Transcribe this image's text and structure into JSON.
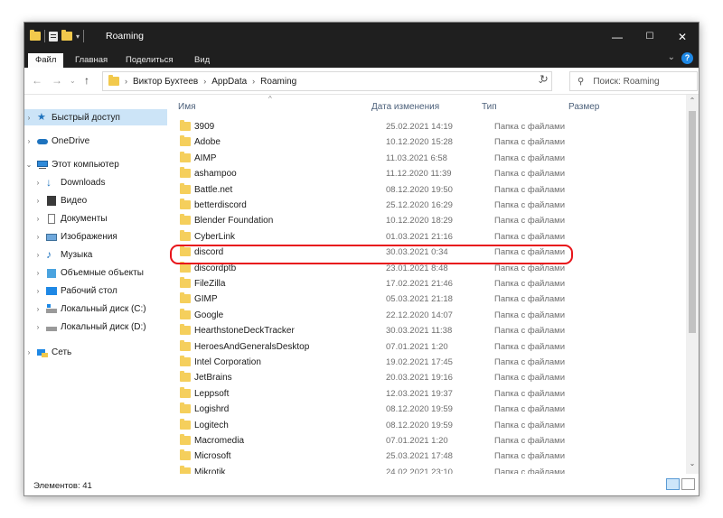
{
  "window": {
    "title": "Roaming",
    "controls": {
      "minimize": "—",
      "maximize": "☐",
      "close": "✕"
    }
  },
  "ribbon": {
    "tabs": [
      "Файл",
      "Главная",
      "Поделиться",
      "Вид"
    ],
    "help": "?"
  },
  "address": {
    "breadcrumbs": [
      "Виктор Бухтеев",
      "AppData",
      "Roaming"
    ],
    "search_placeholder": "Поиск: Roaming"
  },
  "nav": {
    "items": [
      {
        "label": "Быстрый доступ",
        "icon": "star-icon",
        "selected": true
      },
      {
        "label": "OneDrive",
        "icon": "cloud-icon"
      },
      {
        "label": "Этот компьютер",
        "icon": "computer-icon",
        "expanded": true
      },
      {
        "label": "Downloads",
        "icon": "download-icon"
      },
      {
        "label": "Видео",
        "icon": "video-icon"
      },
      {
        "label": "Документы",
        "icon": "document-icon"
      },
      {
        "label": "Изображения",
        "icon": "image-icon"
      },
      {
        "label": "Музыка",
        "icon": "music-icon"
      },
      {
        "label": "Объемные объекты",
        "icon": "cube-icon"
      },
      {
        "label": "Рабочий стол",
        "icon": "desktop-icon"
      },
      {
        "label": "Локальный диск (C:)",
        "icon": "drive-icon"
      },
      {
        "label": "Локальный диск (D:)",
        "icon": "drive-icon"
      },
      {
        "label": "Сеть",
        "icon": "network-icon"
      }
    ]
  },
  "columns": {
    "name": "Имя",
    "date": "Дата изменения",
    "type": "Тип",
    "size": "Размер"
  },
  "files": [
    {
      "name": "3909",
      "date": "25.02.2021 14:19",
      "type": "Папка с файлами"
    },
    {
      "name": "Adobe",
      "date": "10.12.2020 15:28",
      "type": "Папка с файлами"
    },
    {
      "name": "AIMP",
      "date": "11.03.2021 6:58",
      "type": "Папка с файлами"
    },
    {
      "name": "ashampoo",
      "date": "11.12.2020 11:39",
      "type": "Папка с файлами"
    },
    {
      "name": "Battle.net",
      "date": "08.12.2020 19:50",
      "type": "Папка с файлами"
    },
    {
      "name": "betterdiscord",
      "date": "25.12.2020 16:29",
      "type": "Папка с файлами"
    },
    {
      "name": "Blender Foundation",
      "date": "10.12.2020 18:29",
      "type": "Папка с файлами"
    },
    {
      "name": "CyberLink",
      "date": "01.03.2021 21:16",
      "type": "Папка с файлами"
    },
    {
      "name": "discord",
      "date": "30.03.2021 0:34",
      "type": "Папка с файлами",
      "highlighted": true
    },
    {
      "name": "discordptb",
      "date": "23.01.2021 8:48",
      "type": "Папка с файлами"
    },
    {
      "name": "FileZilla",
      "date": "17.02.2021 21:46",
      "type": "Папка с файлами"
    },
    {
      "name": "GIMP",
      "date": "05.03.2021 21:18",
      "type": "Папка с файлами"
    },
    {
      "name": "Google",
      "date": "22.12.2020 14:07",
      "type": "Папка с файлами"
    },
    {
      "name": "HearthstoneDeckTracker",
      "date": "30.03.2021 11:38",
      "type": "Папка с файлами"
    },
    {
      "name": "HeroesAndGeneralsDesktop",
      "date": "07.01.2021 1:20",
      "type": "Папка с файлами"
    },
    {
      "name": "Intel Corporation",
      "date": "19.02.2021 17:45",
      "type": "Папка с файлами"
    },
    {
      "name": "JetBrains",
      "date": "20.03.2021 19:16",
      "type": "Папка с файлами"
    },
    {
      "name": "Leppsoft",
      "date": "12.03.2021 19:37",
      "type": "Папка с файлами"
    },
    {
      "name": "Logishrd",
      "date": "08.12.2020 19:59",
      "type": "Папка с файлами"
    },
    {
      "name": "Logitech",
      "date": "08.12.2020 19:59",
      "type": "Папка с файлами"
    },
    {
      "name": "Macromedia",
      "date": "07.01.2021 1:20",
      "type": "Папка с файлами"
    },
    {
      "name": "Microsoft",
      "date": "25.03.2021 17:48",
      "type": "Папка с файлами"
    },
    {
      "name": "Mikrotik",
      "date": "24.02.2021 23:10",
      "type": "Папка с файлами"
    }
  ],
  "status": {
    "count_text": "Элементов: 41"
  },
  "colors": {
    "titlebar": "#1f1f1f",
    "selection": "#cce4f7",
    "folder": "#f5cf5c",
    "highlight_ring": "#e8141a",
    "accent": "#1e88e5"
  }
}
